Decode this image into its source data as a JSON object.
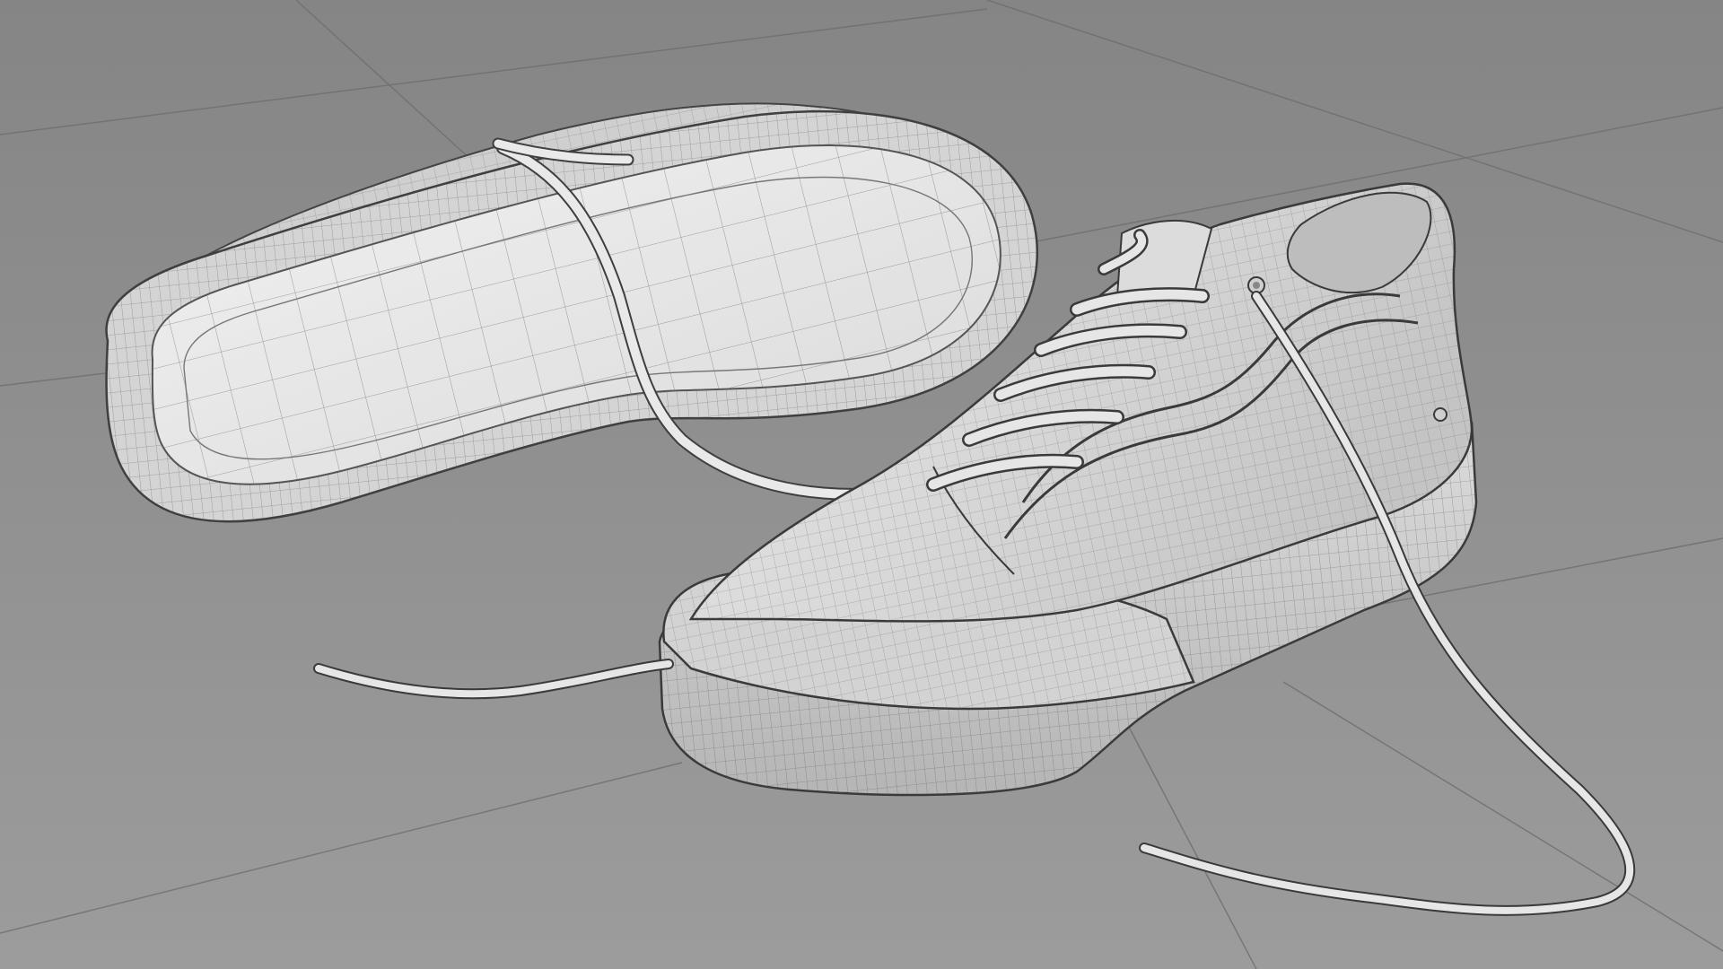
{
  "scene": {
    "subject": "sneaker-pair-wireframe",
    "render_mode": "clay-wireframe",
    "colors": {
      "background_top": "#858585",
      "background_bottom": "#9c9c9c",
      "floor_grid": "#6c6c6c",
      "clay_light": "#ececec",
      "clay_mid": "#d6d6d6",
      "clay_shadow": "#a9a9a9",
      "wire": "#5a5a5a",
      "outline": "#3f3f3f"
    }
  }
}
